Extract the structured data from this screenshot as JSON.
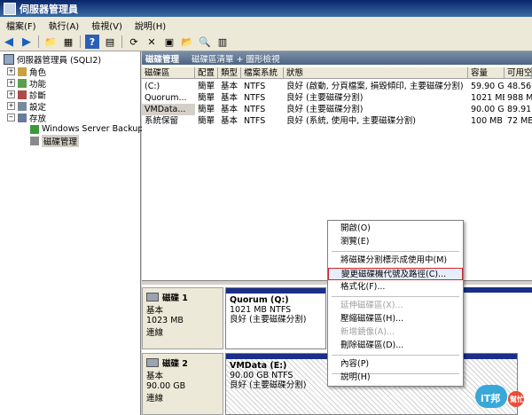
{
  "window": {
    "title": "伺服器管理員"
  },
  "menu": [
    "檔案(F)",
    "執行(A)",
    "檢視(V)",
    "說明(H)"
  ],
  "toolbar_icons": [
    "back-icon",
    "forward-icon",
    "folder-up-icon",
    "tree-icon",
    "help-icon",
    "properties-icon",
    "refresh-icon",
    "delete-icon",
    "export-icon",
    "open-icon",
    "find-icon",
    "disk-icon"
  ],
  "tree": {
    "root": "伺服器管理員 (SQLI2)",
    "items": [
      "角色",
      "功能",
      "診斷",
      "設定",
      "存放",
      "Windows Server Backup",
      "磁碟管理"
    ]
  },
  "panel": {
    "title": "磁碟管理",
    "subtitle": "磁碟區清單 + 圖形檢視"
  },
  "columns": [
    "磁碟區",
    "配置",
    "類型",
    "檔案系統",
    "狀態",
    "容量",
    "可用空"
  ],
  "rows": [
    [
      "(C:)",
      "簡單",
      "基本",
      "NTFS",
      "良好 (啟動, 分頁檔案, 損毀傾印, 主要磁碟分割)",
      "59.90 GB",
      "48.56 G"
    ],
    [
      "Quorum...",
      "簡單",
      "基本",
      "NTFS",
      "良好 (主要磁碟分割)",
      "1021 MB",
      "988 M"
    ],
    [
      "VMData...",
      "簡單",
      "基本",
      "NTFS",
      "良好 (主要磁碟分割)",
      "90.00 GB",
      "89.91 G"
    ],
    [
      "系統保留",
      "簡單",
      "基本",
      "NTFS",
      "良好 (系統, 使用中, 主要磁碟分割)",
      "100 MB",
      "72 ME"
    ]
  ],
  "disks": [
    {
      "name": "磁碟 1",
      "type": "基本",
      "size": "1023 MB",
      "status": "連線",
      "part_title": "Quorum  (Q:)",
      "part_size": "1021 MB NTFS",
      "part_status": "良好 (主要磁碟分割)"
    },
    {
      "name": "磁碟 2",
      "type": "基本",
      "size": "90.00 GB",
      "status": "連線",
      "part_title": "VMData  (E:)",
      "part_size": "90.00 GB NTFS",
      "part_status": "良好 (主要磁碟分割)"
    }
  ],
  "context_menu": [
    {
      "label": "開啟(O)",
      "disabled": false
    },
    {
      "label": "瀏覽(E)",
      "disabled": false
    },
    {
      "label": "將磁碟分割標示成使用中(M)",
      "disabled": false
    },
    {
      "label": "變更磁碟機代號及路徑(C)...",
      "disabled": false,
      "selected": true
    },
    {
      "label": "格式化(F)...",
      "disabled": false
    },
    {
      "label": "延伸磁碟區(X)...",
      "disabled": true
    },
    {
      "label": "壓縮磁碟區(H)...",
      "disabled": false
    },
    {
      "label": "新增鏡像(A)...",
      "disabled": true
    },
    {
      "label": "刪除磁碟區(D)...",
      "disabled": false
    },
    {
      "label": "內容(P)",
      "disabled": false
    },
    {
      "label": "說明(H)",
      "disabled": false
    }
  ],
  "badge": {
    "text": "iT邦",
    "sub": "幫忙",
    "color": "#3aa7d9"
  }
}
